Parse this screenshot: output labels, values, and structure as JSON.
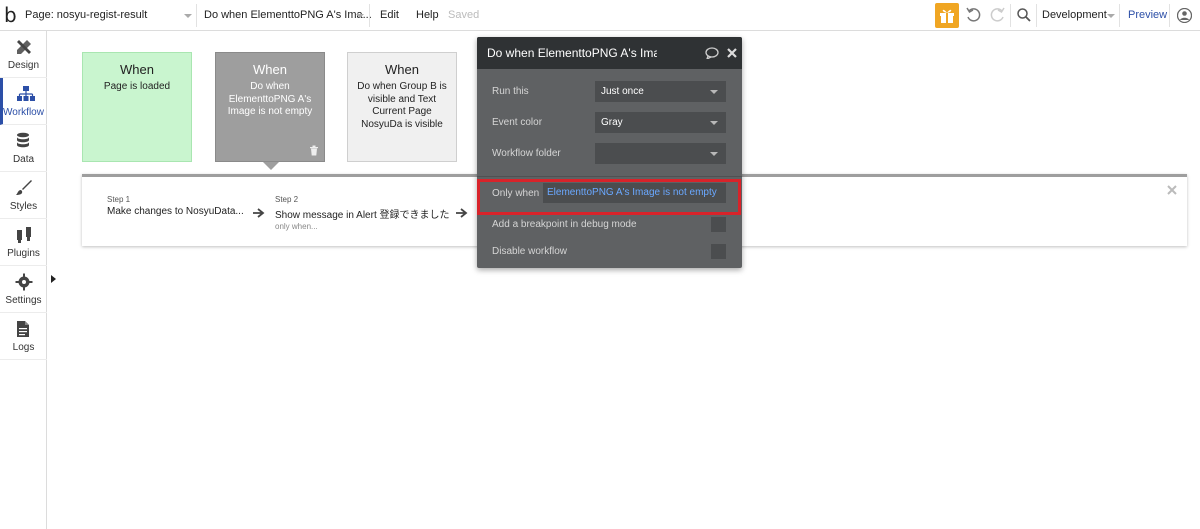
{
  "topbar": {
    "logo": "b",
    "page_selector": "Page: nosyu-regist-result",
    "workflow_selector": "Do when ElementtoPNG A's Ima...",
    "edit": "Edit",
    "help": "Help",
    "saved": "Saved",
    "environment": "Development",
    "preview": "Preview"
  },
  "sidebar": {
    "items": [
      {
        "label": "Design",
        "icon": "design-tools-icon"
      },
      {
        "label": "Workflow",
        "icon": "workflow-icon"
      },
      {
        "label": "Data",
        "icon": "database-icon"
      },
      {
        "label": "Styles",
        "icon": "brush-icon"
      },
      {
        "label": "Plugins",
        "icon": "plug-icon"
      },
      {
        "label": "Settings",
        "icon": "gear-icon"
      },
      {
        "label": "Logs",
        "icon": "document-icon"
      }
    ],
    "active": "Workflow"
  },
  "events": [
    {
      "when": "When",
      "desc": "Page is loaded",
      "color": "#c9f5cf"
    },
    {
      "when": "When",
      "desc": "Do when ElementtoPNG A's Image is not empty",
      "color": "#9e9e9e"
    },
    {
      "when": "When",
      "desc": "Do when Group B is visible and Text Current Page NosyuDa is visible",
      "color": "#f0f0f0"
    }
  ],
  "steps": [
    {
      "num": "Step 1",
      "title": "Make changes to NosyuData...",
      "sub": ""
    },
    {
      "num": "Step 2",
      "title": "Show message in Alert 登録できました",
      "sub": "only when..."
    }
  ],
  "panel": {
    "title": "Do when ElementtoPNG A's Image",
    "run_this_label": "Run this",
    "run_this_value": "Just once",
    "event_color_label": "Event color",
    "event_color_value": "Gray",
    "workflow_folder_label": "Workflow folder",
    "workflow_folder_value": "",
    "only_when_label": "Only when",
    "only_when_value": "ElementtoPNG A's Image is not empty",
    "breakpoint_label": "Add a breakpoint in debug mode",
    "disable_label": "Disable workflow"
  },
  "colors": {
    "accent": "#2c4fa7",
    "highlight": "#d8232a",
    "condition_text": "#6aa8ff",
    "gift": "#f0a623"
  }
}
